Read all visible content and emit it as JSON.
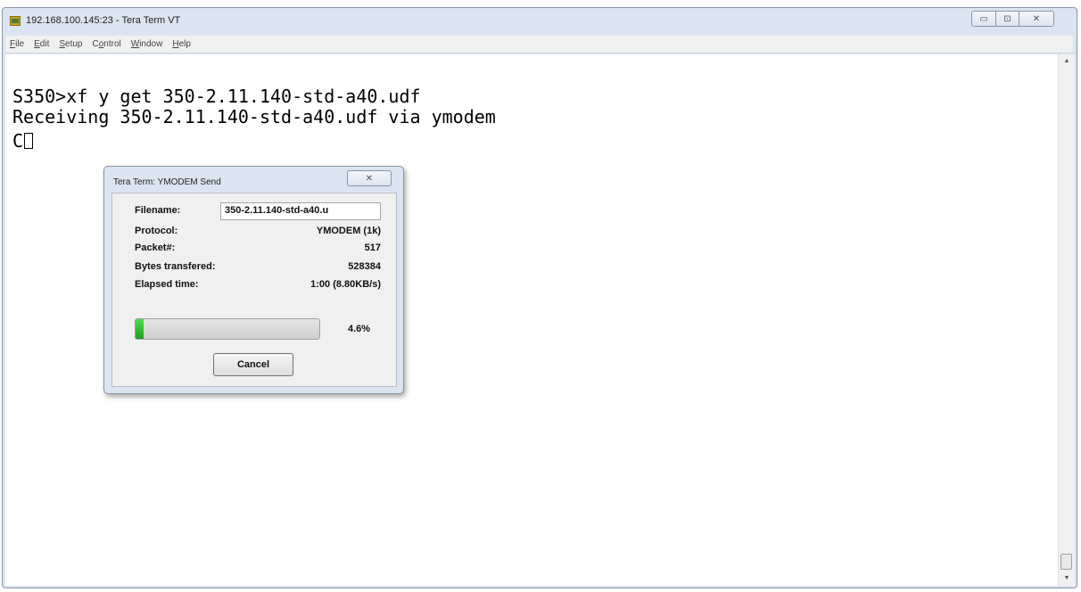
{
  "window": {
    "title": "192.168.100.145:23 - Tera Term VT",
    "icon": "tera-term-icon",
    "controls": {
      "minimize": "▭",
      "maximize": "⊡",
      "close": "✕"
    }
  },
  "menu": [
    {
      "label": "File",
      "underline": "F",
      "rest": "ile"
    },
    {
      "label": "Edit",
      "underline": "E",
      "rest": "dit"
    },
    {
      "label": "Setup",
      "underline": "S",
      "rest": "etup"
    },
    {
      "label": "Control",
      "underline": "o",
      "prefix": "C",
      "rest": "ntrol"
    },
    {
      "label": "Window",
      "underline": "W",
      "rest": "indow"
    },
    {
      "label": "Help",
      "underline": "H",
      "rest": "elp"
    }
  ],
  "terminal": {
    "lines": [
      "S350>xf y get 350-2.11.140-std-a40.udf",
      "Receiving 350-2.11.140-std-a40.udf via ymodem"
    ],
    "cursor_line_text": "C"
  },
  "dialog": {
    "title": "Tera Term: YMODEM Send",
    "close_glyph": "✕",
    "filename_label": "Filename:",
    "filename_value": "350-2.11.140-std-a40.u",
    "protocol_label": "Protocol:",
    "protocol_value": "YMODEM (1k)",
    "packet_label": "Packet#:",
    "packet_value": "517",
    "bytes_label": "Bytes transfered:",
    "bytes_value": "528384",
    "elapsed_label": "Elapsed time:",
    "elapsed_value": "1:00 (8.80KB/s)",
    "progress_percent_text": "4.6%",
    "progress_fraction": 0.046,
    "cancel_label": "Cancel"
  },
  "scrollbar": {
    "up_arrow": "▲",
    "down_arrow": "▼"
  },
  "colors": {
    "progress": "#1fbf1f",
    "window_frame": "#dbe5f1"
  }
}
